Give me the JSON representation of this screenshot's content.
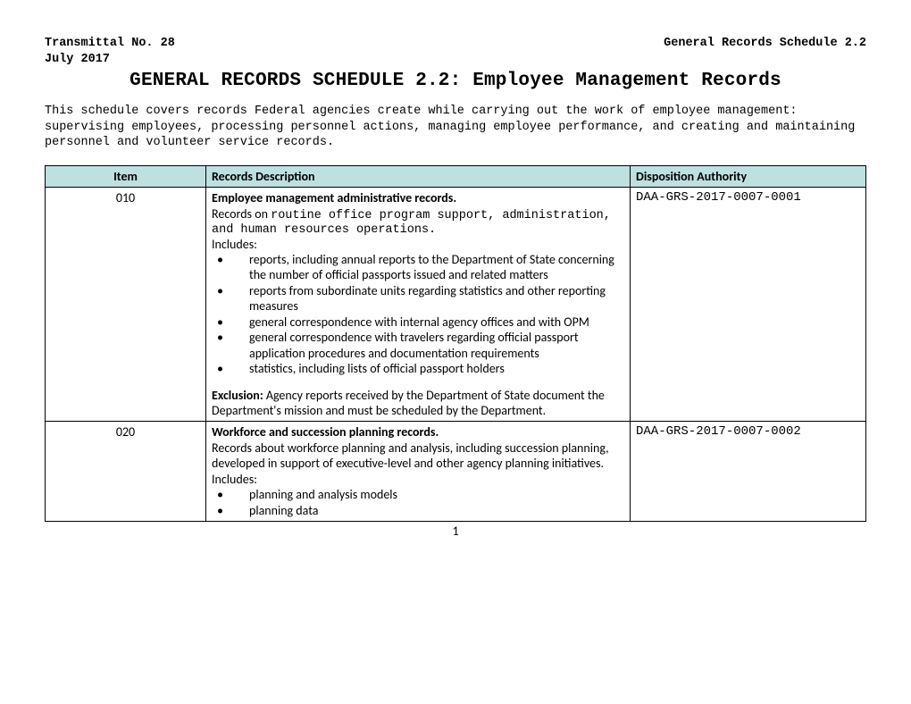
{
  "header": {
    "left": "Transmittal No. 28",
    "right": "General Records Schedule 2.2",
    "date": "July 2017"
  },
  "title": "GENERAL RECORDS SCHEDULE 2.2:  Employee Management Records",
  "intro": "This schedule covers records Federal agencies create while carrying out the work of employee management: supervising employees, processing personnel actions, managing employee performance, and creating and maintaining personnel and volunteer service records.",
  "columns": {
    "item": "Item",
    "desc": "Records Description",
    "disp": "Disposition Authority"
  },
  "rows": [
    {
      "item": "010",
      "title": "Employee management administrative records.",
      "lead_label": "Records on ",
      "lead_mono": "routine office program support, administration, and human resources operations.",
      "includes_label": "Includes:",
      "bullets": [
        "reports, including annual reports to the Department of State concerning the number of official passports issued and related matters",
        "reports from subordinate units regarding statistics and other reporting measures",
        "general correspondence with internal agency offices and with OPM",
        "general correspondence with travelers regarding official passport application procedures and documentation requirements",
        "statistics, including lists of official passport holders"
      ],
      "exclusion_label": "Exclusion:",
      "exclusion_text": "  Agency reports received by the Department of State document the Department's mission and must be scheduled by the Department.",
      "disposition": "DAA-GRS-2017-0007-0001"
    },
    {
      "item": "020",
      "title": "Workforce and succession planning records.",
      "lead_sans": "Records about workforce planning and analysis, including succession planning, developed in support of executive-level and other agency planning initiatives. Includes:",
      "bullets": [
        "planning and analysis models",
        "planning data"
      ],
      "disposition": "DAA-GRS-2017-0007-0002"
    }
  ],
  "page_number": "1"
}
